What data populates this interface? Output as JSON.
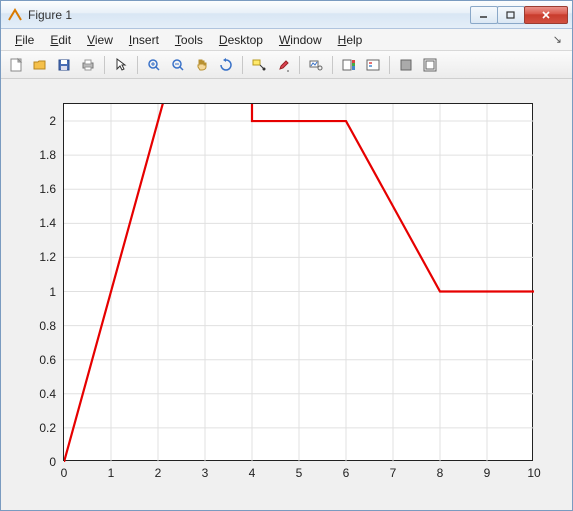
{
  "window": {
    "title": "Figure 1"
  },
  "menubar": {
    "items": [
      {
        "label": "File",
        "accel": "F"
      },
      {
        "label": "Edit",
        "accel": "E"
      },
      {
        "label": "View",
        "accel": "V"
      },
      {
        "label": "Insert",
        "accel": "I"
      },
      {
        "label": "Tools",
        "accel": "T"
      },
      {
        "label": "Desktop",
        "accel": "D"
      },
      {
        "label": "Window",
        "accel": "W"
      },
      {
        "label": "Help",
        "accel": "H"
      }
    ]
  },
  "toolbar": {
    "groups": [
      [
        "new-figure-icon",
        "open-icon",
        "save-icon",
        "print-icon"
      ],
      [
        "pointer-icon"
      ],
      [
        "zoom-in-icon",
        "zoom-out-icon",
        "pan-icon",
        "rotate-icon"
      ],
      [
        "data-cursor-icon",
        "brush-icon"
      ],
      [
        "link-plot-icon"
      ],
      [
        "colorbar-icon",
        "legend-icon"
      ],
      [
        "hide-tools-icon",
        "dock-icon"
      ]
    ]
  },
  "chart_data": {
    "type": "line",
    "x": [
      0,
      2,
      2.2,
      4,
      4,
      6,
      8,
      10
    ],
    "y": [
      0,
      2,
      2.2,
      4.0,
      2,
      2,
      1,
      1
    ],
    "xlim": [
      0,
      10
    ],
    "ylim": [
      0,
      2.1
    ],
    "xticks": [
      0,
      1,
      2,
      3,
      4,
      5,
      6,
      7,
      8,
      9,
      10
    ],
    "yticks": [
      0,
      0.2,
      0.4,
      0.6,
      0.8,
      1,
      1.2,
      1.4,
      1.6,
      1.8,
      2
    ],
    "line_color": "#e60000",
    "line_width": 2.2,
    "grid": true,
    "title": "",
    "xlabel": "",
    "ylabel": ""
  }
}
